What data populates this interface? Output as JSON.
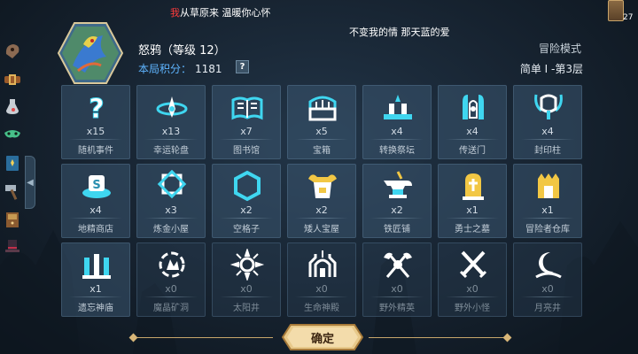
{
  "lyrics": {
    "first_char": "我",
    "line1_rest": "从草原来 温暖你心怀",
    "line2": "不变我的情 那天蓝的爱"
  },
  "top_right": {
    "count": "27",
    "icon": "card-deck-icon"
  },
  "player": {
    "name": "怒鸦（等级 12）",
    "score_label": "本局积分：",
    "score_value": "1181",
    "help": "?"
  },
  "mode": {
    "label": "冒险模式",
    "difficulty": "简单 I -第3层"
  },
  "sidebar": {
    "items": [
      {
        "icon": "crow-mask-icon"
      },
      {
        "icon": "belt-icon"
      },
      {
        "icon": "potion-icon"
      },
      {
        "icon": "green-mask-icon"
      },
      {
        "icon": "spellbook-icon"
      },
      {
        "icon": "hammer-icon"
      },
      {
        "icon": "cabinet-icon"
      },
      {
        "icon": "top-hat-icon"
      }
    ],
    "toggle": "◀"
  },
  "events": [
    {
      "name": "随机事件",
      "count": "x15",
      "icon": "question-mark-icon"
    },
    {
      "name": "幸运轮盘",
      "count": "x13",
      "icon": "roulette-icon"
    },
    {
      "name": "图书馆",
      "count": "x7",
      "icon": "book-icon"
    },
    {
      "name": "宝箱",
      "count": "x5",
      "icon": "chest-icon"
    },
    {
      "name": "转换祭坛",
      "count": "x4",
      "icon": "altar-icon"
    },
    {
      "name": "传送门",
      "count": "x4",
      "icon": "portal-icon"
    },
    {
      "name": "封印柱",
      "count": "x4",
      "icon": "seal-pillar-icon"
    },
    {
      "name": "地精商店",
      "count": "x4",
      "icon": "goblin-shop-icon"
    },
    {
      "name": "炼金小屋",
      "count": "x3",
      "icon": "alchemy-icon"
    },
    {
      "name": "空格子",
      "count": "x2",
      "icon": "hexagon-icon"
    },
    {
      "name": "矮人宝屋",
      "count": "x2",
      "icon": "dwarf-treasure-icon"
    },
    {
      "name": "铁匠铺",
      "count": "x2",
      "icon": "anvil-icon"
    },
    {
      "name": "勇士之墓",
      "count": "x1",
      "icon": "tomb-icon"
    },
    {
      "name": "冒险者仓库",
      "count": "x1",
      "icon": "warehouse-icon"
    },
    {
      "name": "遗忘神庙",
      "count": "x1",
      "icon": "temple-icon"
    },
    {
      "name": "魔晶矿洞",
      "count": "x0",
      "icon": "crystal-mine-icon"
    },
    {
      "name": "太阳井",
      "count": "x0",
      "icon": "sun-well-icon"
    },
    {
      "name": "生命神殿",
      "count": "x0",
      "icon": "life-shrine-icon"
    },
    {
      "name": "野外精英",
      "count": "x0",
      "icon": "elite-axes-icon"
    },
    {
      "name": "野外小怪",
      "count": "x0",
      "icon": "crossed-swords-icon"
    },
    {
      "name": "月亮井",
      "count": "x0",
      "icon": "moon-well-icon"
    }
  ],
  "confirm_label": "确定",
  "colors": {
    "accent_blue": "#5fb5ff",
    "icon_cyan": "#3fd6f0",
    "icon_gold": "#f2c744",
    "dim_white": "#dfe6ee"
  }
}
